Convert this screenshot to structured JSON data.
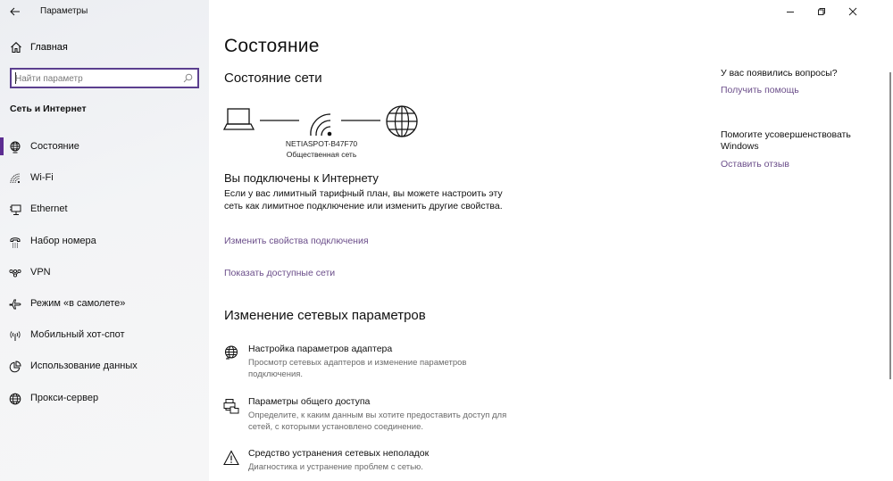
{
  "window": {
    "title": "Параметры",
    "controls": {
      "minimize": "minimize",
      "maximize": "restore",
      "close": "close"
    }
  },
  "sidebar": {
    "home_label": "Главная",
    "search_placeholder": "Найти параметр",
    "section_title": "Сеть и Интернет",
    "items": [
      {
        "label": "Состояние",
        "icon": "network-status-icon",
        "selected": true
      },
      {
        "label": "Wi-Fi",
        "icon": "wifi-icon"
      },
      {
        "label": "Ethernet",
        "icon": "ethernet-icon"
      },
      {
        "label": "Набор номера",
        "icon": "dialup-icon"
      },
      {
        "label": "VPN",
        "icon": "vpn-icon"
      },
      {
        "label": "Режим «в самолете»",
        "icon": "airplane-icon"
      },
      {
        "label": "Мобильный хот-спот",
        "icon": "hotspot-icon"
      },
      {
        "label": "Использование данных",
        "icon": "data-usage-icon"
      },
      {
        "label": "Прокси-сервер",
        "icon": "globe-icon"
      }
    ]
  },
  "main": {
    "title": "Состояние",
    "network_status_heading": "Состояние сети",
    "network": {
      "name": "NETIASPOT-B47F70",
      "type": "Общественная сеть"
    },
    "connected_title": "Вы подключены к Интернету",
    "connected_desc": "Если у вас лимитный тарифный план, вы можете настроить эту сеть как лимитное подключение или изменить другие свойства.",
    "links": {
      "change_props": "Изменить свойства подключения",
      "show_networks": "Показать доступные сети"
    },
    "change_settings_heading": "Изменение сетевых параметров",
    "options": [
      {
        "title": "Настройка параметров адаптера",
        "desc": "Просмотр сетевых адаптеров и изменение параметров подключения.",
        "icon": "adapter-icon"
      },
      {
        "title": "Параметры общего доступа",
        "desc": "Определите, к каким данным вы хотите предоставить доступ для сетей, с которыми установлено соединение.",
        "icon": "sharing-icon"
      },
      {
        "title": "Средство устранения сетевых неполадок",
        "desc": "Диагностика и устранение проблем с сетью.",
        "icon": "warning-icon"
      }
    ]
  },
  "right_panel": {
    "questions": "У вас появились вопросы?",
    "get_help": "Получить помощь",
    "improve": "Помогите усовершенствовать Windows",
    "feedback": "Оставить отзыв"
  },
  "colors": {
    "accent": "#5c2d91",
    "link": "#6b4e8a",
    "search_border": "#5b3f8f"
  }
}
